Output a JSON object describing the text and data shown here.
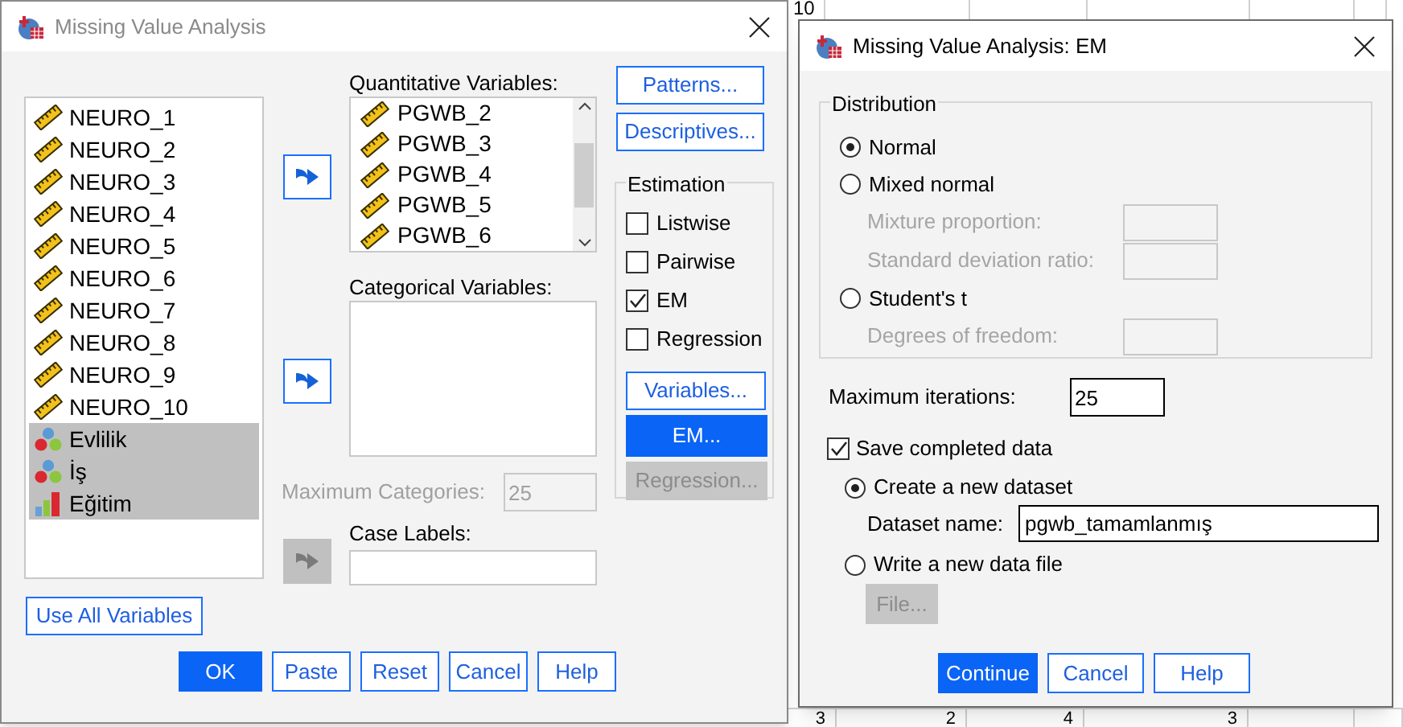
{
  "background_sheet": {
    "top_cells": [
      "10"
    ],
    "bottom_cells": [
      "3",
      "2",
      "4",
      "3"
    ]
  },
  "main_dialog": {
    "title": "Missing Value Analysis",
    "variables": [
      {
        "name": "NEURO_1",
        "kind": "scale",
        "selected": false
      },
      {
        "name": "NEURO_2",
        "kind": "scale",
        "selected": false
      },
      {
        "name": "NEURO_3",
        "kind": "scale",
        "selected": false
      },
      {
        "name": "NEURO_4",
        "kind": "scale",
        "selected": false
      },
      {
        "name": "NEURO_5",
        "kind": "scale",
        "selected": false
      },
      {
        "name": "NEURO_6",
        "kind": "scale",
        "selected": false
      },
      {
        "name": "NEURO_7",
        "kind": "scale",
        "selected": false
      },
      {
        "name": "NEURO_8",
        "kind": "scale",
        "selected": false
      },
      {
        "name": "NEURO_9",
        "kind": "scale",
        "selected": false
      },
      {
        "name": "NEURO_10",
        "kind": "scale",
        "selected": false
      },
      {
        "name": "Evlilik",
        "kind": "nominal",
        "selected": true
      },
      {
        "name": "İş",
        "kind": "nominal",
        "selected": true
      },
      {
        "name": "Eğitim",
        "kind": "ordinal",
        "selected": true
      }
    ],
    "arrow_buttons": [
      {
        "disabled": false
      },
      {
        "disabled": false
      },
      {
        "disabled": true
      }
    ],
    "quantitative_label": "Quantitative Variables:",
    "quantitative_variables": [
      {
        "name": "PGWB_2",
        "kind": "scale"
      },
      {
        "name": "PGWB_3",
        "kind": "scale"
      },
      {
        "name": "PGWB_4",
        "kind": "scale"
      },
      {
        "name": "PGWB_5",
        "kind": "scale"
      },
      {
        "name": "PGWB_6",
        "kind": "scale"
      }
    ],
    "categorical_label": "Categorical Variables:",
    "max_categories": {
      "label": "Maximum Categories:",
      "value": "25",
      "disabled": true
    },
    "case_labels": {
      "label": "Case Labels:"
    },
    "side_buttons": [
      {
        "label": "Patterns..."
      },
      {
        "label": "Descriptives..."
      }
    ],
    "estimation": {
      "title": "Estimation",
      "options": [
        {
          "label": "Listwise",
          "checked": false
        },
        {
          "label": "Pairwise",
          "checked": false
        },
        {
          "label": "EM",
          "checked": true
        },
        {
          "label": "Regression",
          "checked": false
        }
      ],
      "buttons": [
        {
          "label": "Variables...",
          "kind": "normal"
        },
        {
          "label": "EM...",
          "kind": "default"
        },
        {
          "label": "Regression...",
          "kind": "disabled"
        }
      ]
    },
    "use_all_button": "Use All Variables",
    "buttons": [
      {
        "label": "OK",
        "default": true
      },
      {
        "label": "Paste",
        "default": false
      },
      {
        "label": "Reset",
        "default": false
      },
      {
        "label": "Cancel",
        "default": false
      },
      {
        "label": "Help",
        "default": false
      }
    ]
  },
  "em_dialog": {
    "title": "Missing Value Analysis: EM",
    "distribution": {
      "title": "Distribution",
      "options": [
        {
          "label": "Normal",
          "selected": true
        },
        {
          "label": "Mixed normal",
          "selected": false,
          "fields": [
            {
              "label": "Mixture proportion:",
              "disabled": true
            },
            {
              "label": "Standard deviation ratio:",
              "disabled": true
            }
          ]
        },
        {
          "label": "Student's t",
          "selected": false,
          "fields": [
            {
              "label": "Degrees of freedom:",
              "disabled": true
            }
          ]
        }
      ]
    },
    "max_iterations": {
      "label": "Maximum iterations:",
      "value": "25"
    },
    "save_completed": {
      "label": "Save completed data",
      "checked": true,
      "options": [
        {
          "kind": "field",
          "label": "Create a new dataset",
          "selected": true,
          "field_label": "Dataset name:",
          "value": "pgwb_tamamlanmış"
        },
        {
          "kind": "button",
          "label": "Write a new data file",
          "selected": false,
          "button_label": "File...",
          "disabled": true
        }
      ]
    },
    "buttons": [
      {
        "label": "Continue",
        "default": true
      },
      {
        "label": "Cancel",
        "default": false
      },
      {
        "label": "Help",
        "default": false
      }
    ]
  }
}
